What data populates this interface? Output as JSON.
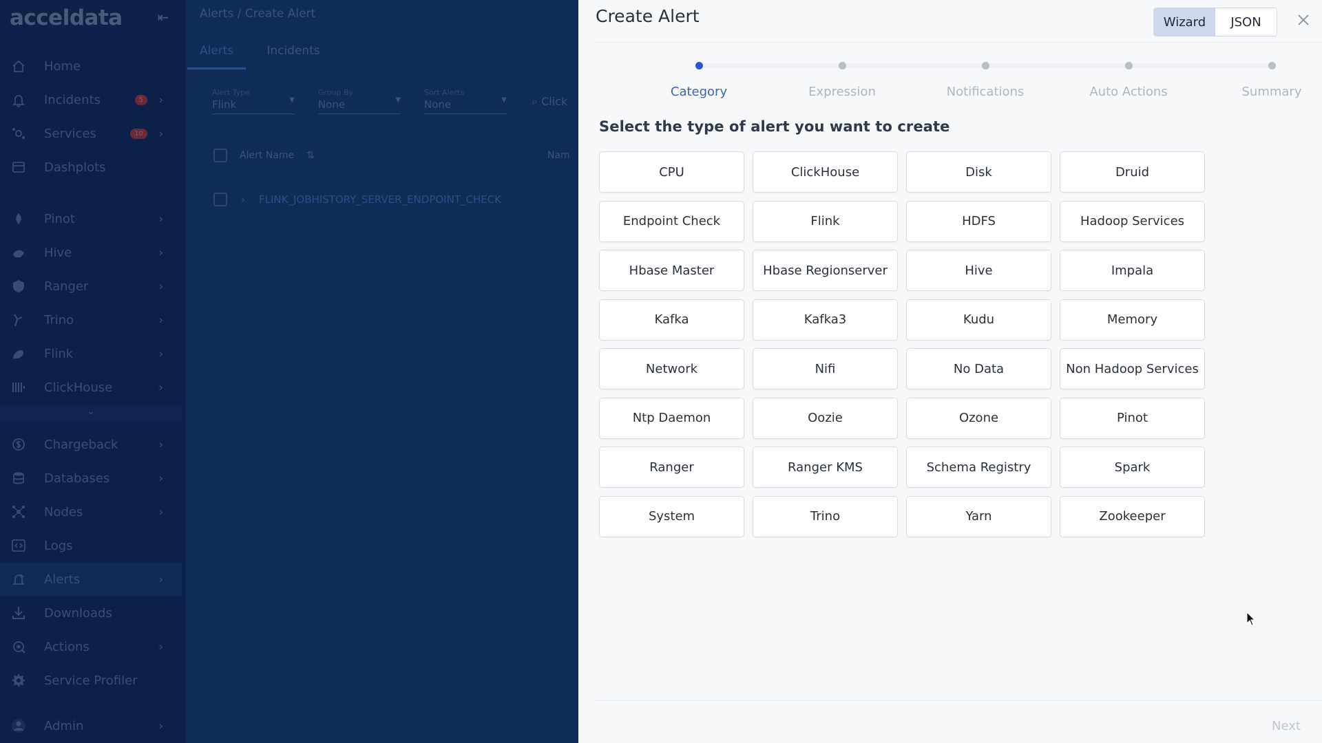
{
  "app": {
    "logo": "acceldata",
    "collapse_glyph": "⇤"
  },
  "sidebar": {
    "items": [
      {
        "label": "Home",
        "icon": "home-icon"
      },
      {
        "label": "Incidents",
        "icon": "bell-icon",
        "badge": "5",
        "chevron": "›"
      },
      {
        "label": "Services",
        "icon": "services-icon",
        "badge": "10",
        "chevron": "›"
      },
      {
        "label": "Dashplots",
        "icon": "dashboard-icon"
      },
      {
        "label": "Pinot",
        "icon": "pinot-icon",
        "chevron": "›"
      },
      {
        "label": "Hive",
        "icon": "hive-icon",
        "chevron": "›"
      },
      {
        "label": "Ranger",
        "icon": "ranger-icon",
        "chevron": "›"
      },
      {
        "label": "Trino",
        "icon": "trino-icon",
        "chevron": "›"
      },
      {
        "label": "Flink",
        "icon": "flink-icon",
        "chevron": "›"
      },
      {
        "label": "ClickHouse",
        "icon": "clickhouse-icon",
        "chevron": "›"
      },
      {
        "label": "Chargeback",
        "icon": "dollar-icon",
        "chevron": "›"
      },
      {
        "label": "Databases",
        "icon": "database-icon",
        "chevron": "›"
      },
      {
        "label": "Nodes",
        "icon": "nodes-icon",
        "chevron": "›"
      },
      {
        "label": "Logs",
        "icon": "code-icon"
      },
      {
        "label": "Alerts",
        "icon": "alert-icon",
        "chevron": "›",
        "active": true
      },
      {
        "label": "Downloads",
        "icon": "download-icon"
      },
      {
        "label": "Actions",
        "icon": "actions-icon",
        "chevron": "›"
      },
      {
        "label": "Service Profiler",
        "icon": "profiler-icon"
      },
      {
        "label": "Admin",
        "icon": "user-icon",
        "chevron": "›"
      }
    ],
    "more_glyph": "⌄"
  },
  "main": {
    "breadcrumb": "Alerts  /  Create Alert",
    "tabs": [
      "Alerts",
      "Incidents"
    ],
    "filters": [
      {
        "label": "Alert Type",
        "value": "Flink"
      },
      {
        "label": "Group By",
        "value": "None"
      },
      {
        "label": "Sort Alerts",
        "value": "None"
      }
    ],
    "search_placeholder": "Click",
    "table_header": "Alert Name",
    "nam_col": "Nam",
    "row_name": "FLINK_JOBHISTORY_SERVER_ENDPOINT_CHECK"
  },
  "modal": {
    "title": "Create Alert",
    "view_toggle": {
      "wizard": "Wizard",
      "json": "JSON",
      "active": "Wizard"
    },
    "steps": [
      "Category",
      "Expression",
      "Notifications",
      "Auto Actions",
      "Summary"
    ],
    "current_step": 0,
    "subtitle": "Select the type of alert you want to create",
    "categories": [
      "CPU",
      "ClickHouse",
      "Disk",
      "Druid",
      "Endpoint Check",
      "Flink",
      "HDFS",
      "Hadoop Services",
      "Hbase Master",
      "Hbase Regionserver",
      "Hive",
      "Impala",
      "Kafka",
      "Kafka3",
      "Kudu",
      "Memory",
      "Network",
      "Nifi",
      "No Data",
      "Non Hadoop Services",
      "Ntp Daemon",
      "Oozie",
      "Ozone",
      "Pinot",
      "Ranger",
      "Ranger KMS",
      "Schema Registry",
      "Spark",
      "System",
      "Trino",
      "Yarn",
      "Zookeeper"
    ],
    "next_label": "Next"
  },
  "colors": {
    "sidebar_bg": "#0e2249",
    "overlay_bg": "#122c5a",
    "accent": "#2d56c5",
    "modal_bg": "#f7f8fa"
  }
}
